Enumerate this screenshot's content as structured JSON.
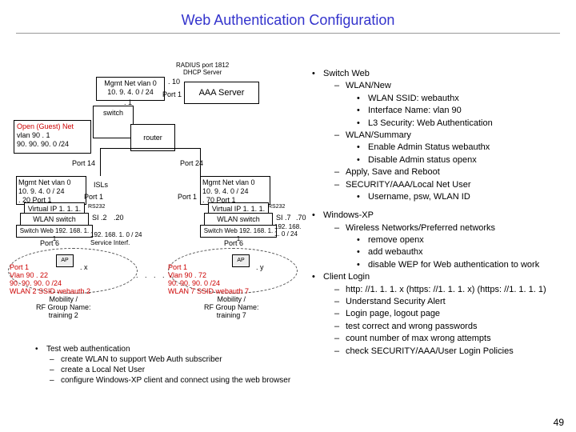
{
  "title": "Web Authentication Configuration",
  "radius_label": "RADIUS port 1812\nDHCP Server",
  "aaa_server": "AAA Server",
  "mgmt_top": {
    "line1": "Mgmt Net vlan 0",
    "line2": "10. 9. 4. 0 / 24",
    "dot1": ". 1",
    "dot10": ". 10",
    "port": "Port 1"
  },
  "switch_label": "switch",
  "router_label": "router",
  "guest": {
    "title": "Open (Guest) Net",
    "vlan": "vlan 90",
    "dot1": ". 1",
    "subnet": "90. 90. 90. 0 /24"
  },
  "port14": "Port 14",
  "port24": "Port 24",
  "left_ctrl": {
    "mgmt1": "Mgmt Net vlan 0",
    "mgmt2": "10. 9. 4. 0 / 24",
    "mgmt3": ". 20 Port 1",
    "vip": "Virtual IP 1. 1. 1. 1",
    "wlan": "WLAN switch",
    "web": "Switch Web 192. 168. 1. 1",
    "si2": "SI .2",
    "si20": ".20",
    "rs232": "RS232",
    "port6": "Port 6",
    "subnet": "192. 168. 1. 0 / 24",
    "svcif": "Service Interf."
  },
  "right_ctrl": {
    "mgmt1": "Mgmt Net vlan 0",
    "mgmt2": "10. 9. 4. 0 / 24",
    "mgmt3": ". 70 Port 1",
    "vip": "Virtual IP 1. 1. 1. 1",
    "wlan": "WLAN switch",
    "web": "Switch Web 192. 168. 1. 1",
    "si7": "SI .7",
    "si70": ".70",
    "rs232": "RS232",
    "port6": "Port 6",
    "subnet": "192. 168. 1. 0 / 24"
  },
  "isls": "ISLs",
  "port1": "Port 1",
  "left_ap": {
    "ap": "AP",
    "dotx": ". x",
    "p1": "Port 1",
    "p2": "Vlan 90 . 22",
    "p3": "90. 90. 90. 0 /24",
    "p4": "WLAN 2 SSID webauth 2",
    "p5": "Mobility /",
    "p6": "RF Group Name:",
    "p7": "training 2"
  },
  "right_ap": {
    "ap": "AP",
    "doty": ". y",
    "p1": "Port 1",
    "p2": "Vlan 90 . 72",
    "p3": "90. 90. 90. 0 /24",
    "p4": "WLAN 7 SSID webauth 7",
    "p5": "Mobility /",
    "p6": "RF Group Name:",
    "p7": "training 7"
  },
  "testauth": {
    "head": "Test web authentication",
    "i1": "create WLAN to support Web Auth subscriber",
    "i2": "create a Local Net User",
    "i3": "configure Windows-XP client and connect using the web browser"
  },
  "bul": {
    "sw": "Switch Web",
    "wn": "WLAN/New",
    "wn1": "WLAN SSID: webauthx",
    "wn2": "Interface Name: vlan 90",
    "wn3": "L3 Security: Web Authentication",
    "ws": "WLAN/Summary",
    "ws1": "Enable Admin Status webauthx",
    "ws2": "Disable Admin status openx",
    "apr": "Apply, Save and Reboot",
    "sec": "SECURITY/AAA/Local Net User",
    "sec1": "Username, psw, WLAN ID",
    "xp": "Windows-XP",
    "xp1": "Wireless Networks/Preferred networks",
    "xp1a": "remove openx",
    "xp1b": "add webauthx",
    "xp1c": "disable WEP for Web authentication to work",
    "cl": "Client Login",
    "cl1": "http: //1. 1. 1. x (https: //1. 1. 1. x) (https: //1. 1. 1. 1)",
    "cl2": "Understand Security Alert",
    "cl3": "Login page, logout page",
    "cl4": "test correct and wrong passwords",
    "cl5": "count number of max wrong attempts",
    "cl6": "check SECURITY/AAA/User Login Policies"
  },
  "slide": "49"
}
